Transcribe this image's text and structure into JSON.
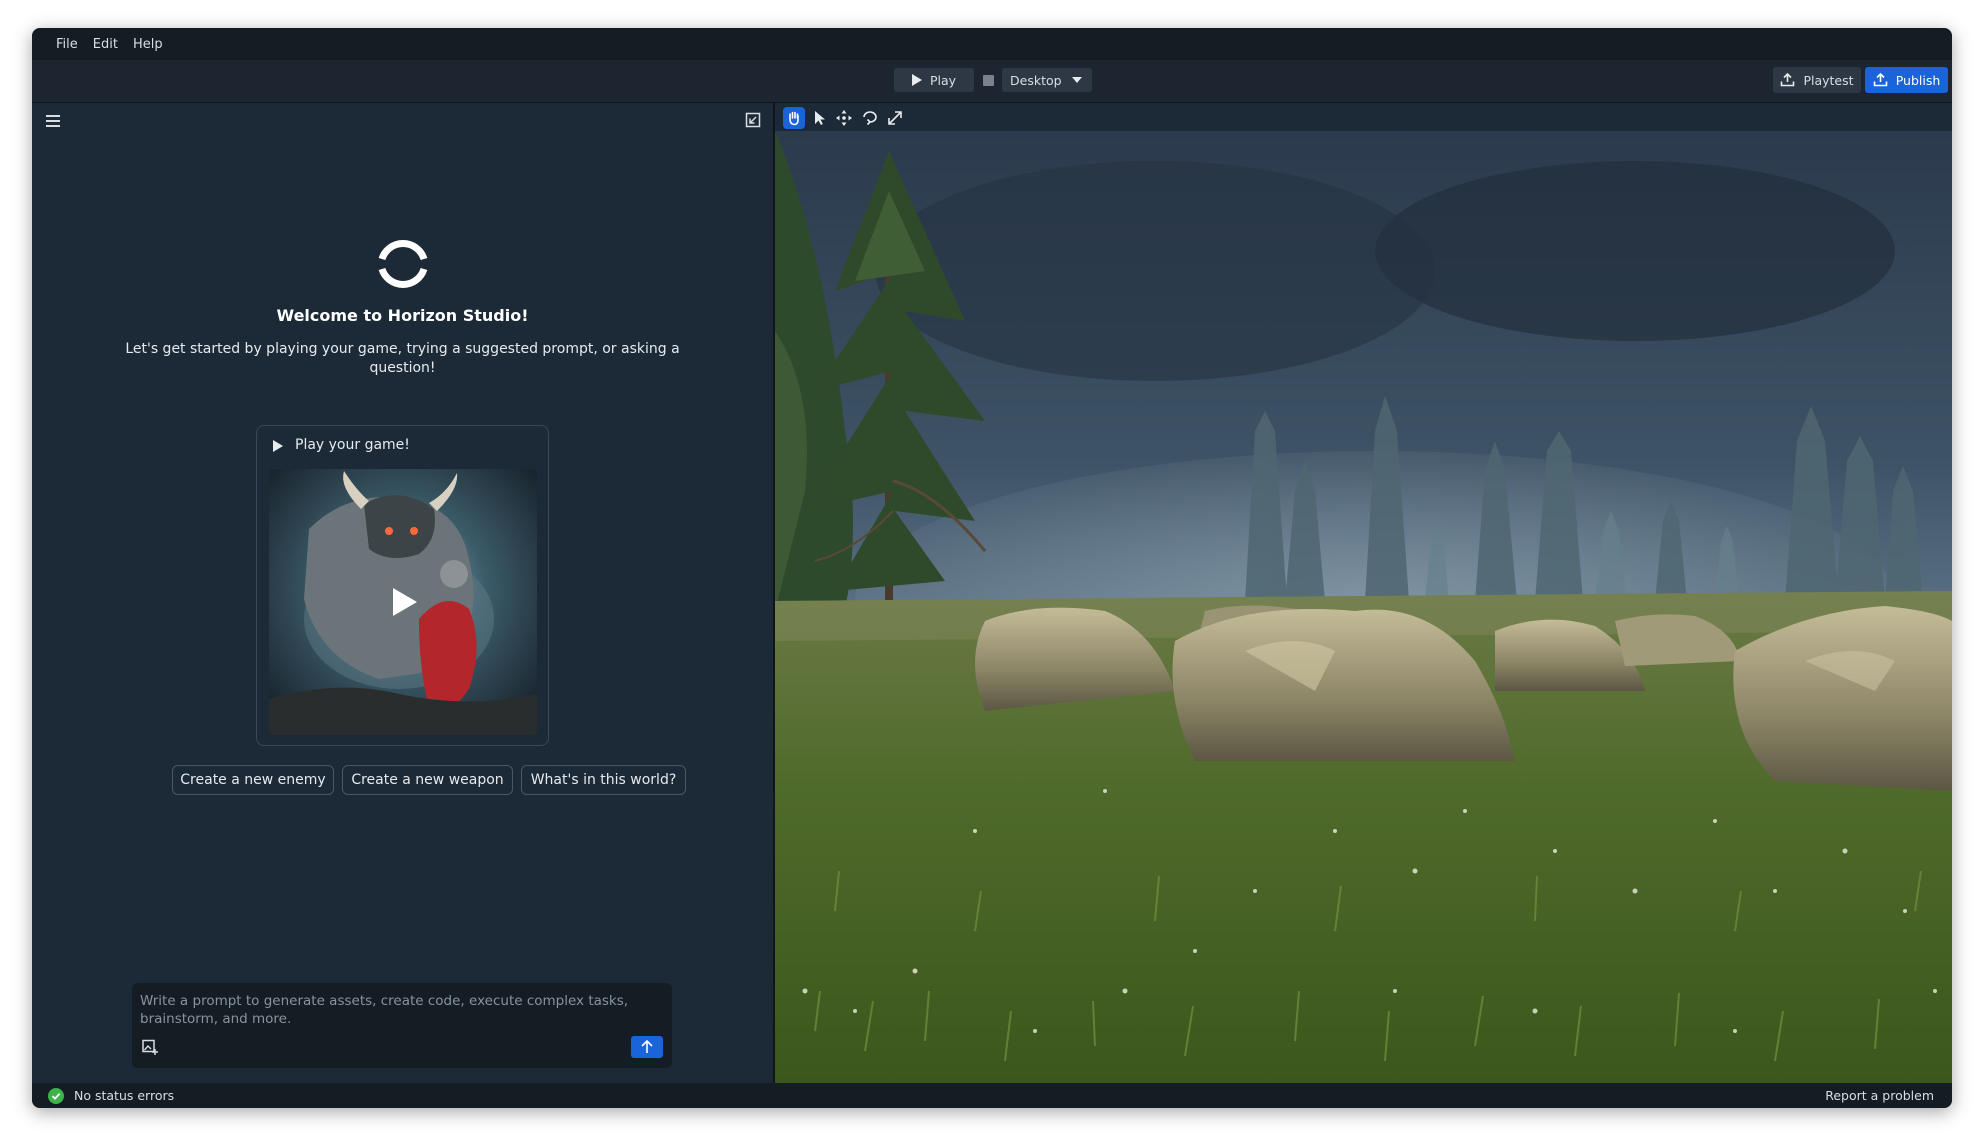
{
  "menu": {
    "file": "File",
    "edit": "Edit",
    "help": "Help"
  },
  "toolbar": {
    "play": "Play",
    "device": "Desktop",
    "playtest": "Playtest",
    "publish": "Publish"
  },
  "panel": {
    "welcome": "Welcome to Horizon Studio!",
    "subtitle": "Let's get started by playing your game, trying a suggested prompt, or asking a question!",
    "card_title": "Play your game!",
    "chips": [
      "Create a new enemy",
      "Create a new weapon",
      "What's in this world?"
    ],
    "prompt_placeholder": "Write a prompt to generate assets, create code, execute complex tasks, brainstorm, and more."
  },
  "status": {
    "text": "No status errors",
    "report": "Report a problem"
  },
  "colors": {
    "accent": "#1a63d8",
    "ok": "#3cb44a",
    "panel": "#1c2a37",
    "bar": "#141c24"
  },
  "icons": {
    "hamburger": "hamburger-icon",
    "collapse": "collapse-panel-icon",
    "pan": "hand-icon",
    "select": "cursor-icon",
    "move": "move-icon",
    "rotate": "rotate-icon",
    "scale": "scale-icon",
    "send": "arrow-up-icon",
    "image": "image-add-icon"
  }
}
